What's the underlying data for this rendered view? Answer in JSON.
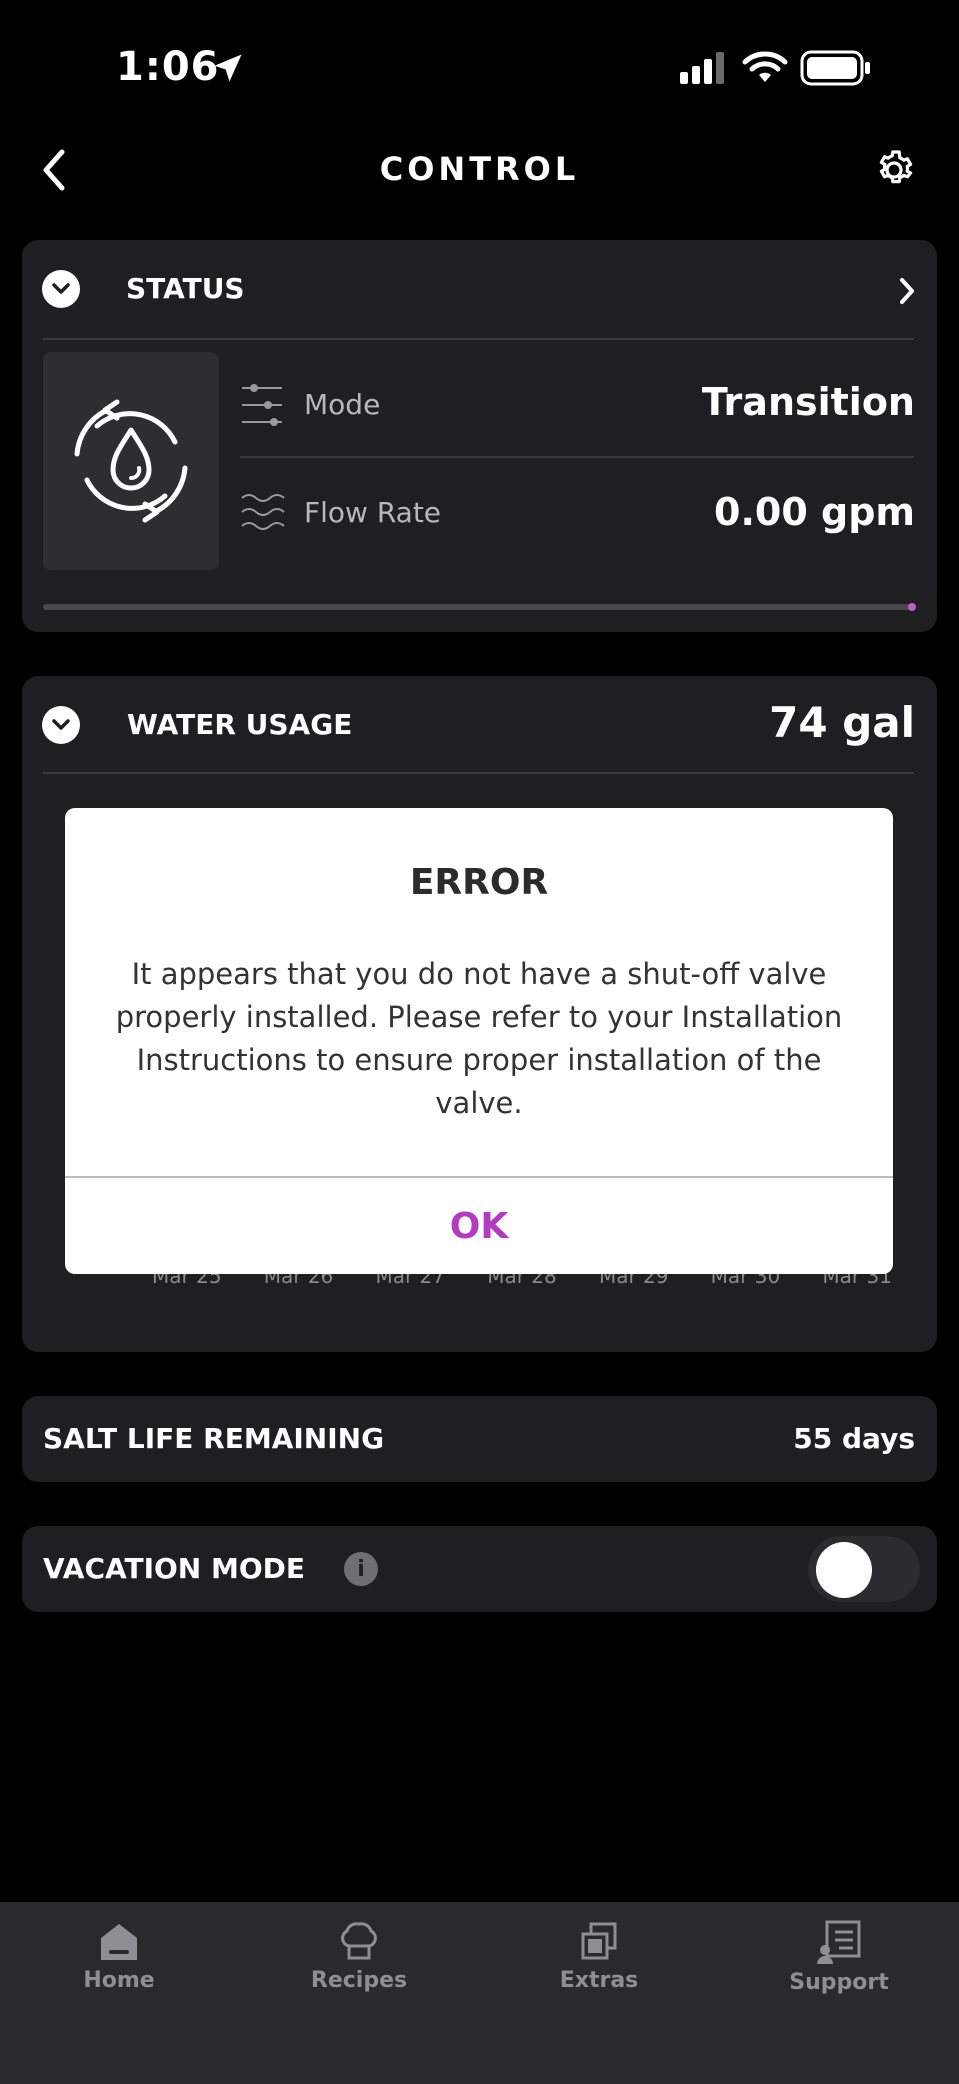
{
  "status_bar": {
    "time": "1:06"
  },
  "header": {
    "title": "CONTROL"
  },
  "status_card": {
    "title": "STATUS",
    "mode_label": "Mode",
    "mode_value": "Transition",
    "flow_label": "Flow Rate",
    "flow_value": "0.00 gpm"
  },
  "usage_card": {
    "title": "WATER USAGE",
    "total": "74 gal",
    "axis_labels": [
      "Mar 25",
      "Mar 26",
      "Mar 27",
      "Mar 28",
      "Mar 29",
      "Mar 30",
      "Mar 31"
    ]
  },
  "dialog": {
    "title": "ERROR",
    "message": "It appears that you do not have a shut-off valve properly installed. Please refer to your Installation Instructions to ensure proper installation of the valve.",
    "ok_label": "OK"
  },
  "salt_card": {
    "title": "SALT LIFE REMAINING",
    "value": "55 days"
  },
  "vacation_card": {
    "title": "VACATION MODE",
    "info": "i",
    "enabled": false
  },
  "tabs": [
    {
      "label": "Home",
      "icon": "home-icon"
    },
    {
      "label": "Recipes",
      "icon": "chef-hat-icon"
    },
    {
      "label": "Extras",
      "icon": "extras-icon"
    },
    {
      "label": "Support",
      "icon": "support-icon"
    }
  ],
  "colors": {
    "accent": "#b23bbf",
    "card": "#1f1f21",
    "background": "#000000"
  }
}
